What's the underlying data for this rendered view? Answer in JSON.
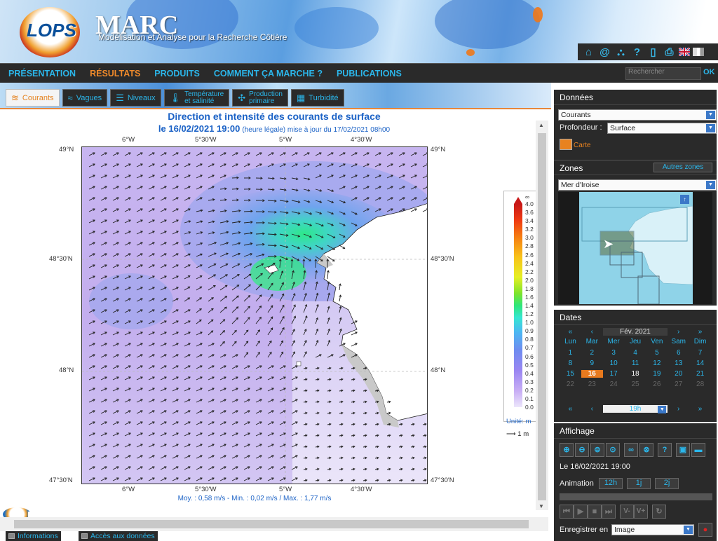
{
  "header": {
    "logo": "LOPS",
    "title": "MARC",
    "subtitle": "Modélisation et Analyse pour la Recherche Côtière"
  },
  "tools": [
    "home-icon",
    "at-icon",
    "sitemap-icon",
    "help-icon",
    "mobile-icon",
    "print-icon",
    "flag-uk-icon",
    "flag-fr-icon"
  ],
  "nav": {
    "items": [
      "PRÉSENTATION",
      "RÉSULTATS",
      "PRODUITS",
      "COMMENT ÇA MARCHE ?",
      "PUBLICATIONS"
    ],
    "active": "RÉSULTATS",
    "search_placeholder": "Rechercher",
    "search_ok": "OK"
  },
  "tabs": [
    {
      "label": "Courants",
      "active": true
    },
    {
      "label": "Vagues"
    },
    {
      "label": "Niveaux"
    },
    {
      "label1": "Température",
      "label2": "et salinité"
    },
    {
      "label1": "Production",
      "label2": "primaire"
    },
    {
      "label": "Turbidité"
    }
  ],
  "map": {
    "title": "Direction et intensité des courants de surface",
    "date": "le 16/02/2021 19:00",
    "date_note": "(heure légale) mise à jour du 17/02/2021 08h00",
    "lon_labels": [
      "6°W",
      "5°30'W",
      "5°W",
      "4°30'W"
    ],
    "lat_labels": [
      "49°N",
      "48°30'N",
      "48°N",
      "47°30'N"
    ],
    "stats": "Moy. : 0,58 m/s   -   Min. : 0,02 m/s / Max. : 1,77 m/s",
    "colorbar_ticks": [
      "4.0",
      "3.6",
      "3.4",
      "3.2",
      "3.0",
      "2.8",
      "2.6",
      "2.4",
      "2.2",
      "2.0",
      "1.8",
      "1.6",
      "1.4",
      "1.2",
      "1.0",
      "0.9",
      "0.8",
      "0.7",
      "0.6",
      "0.5",
      "0.4",
      "0.3",
      "0.2",
      "0.1",
      "0.0"
    ],
    "colorbar_top": "∞",
    "unit_label": "Unité: m",
    "scale_label": "1 m"
  },
  "footer": {
    "info": "Informations",
    "access": "Accès aux données"
  },
  "panel_data": {
    "title": "Données",
    "variable": "Courants",
    "depth_label": "Profondeur :",
    "depth": "Surface",
    "map_link": "Carte"
  },
  "panel_zones": {
    "title": "Zones",
    "other_btn": "Autres zones",
    "zone": "Mer d'Iroise"
  },
  "panel_dates": {
    "title": "Dates",
    "nav_prev2": "«",
    "nav_prev": "‹",
    "month": "Fév. 2021",
    "nav_next": "›",
    "nav_next2": "»",
    "weekdays": [
      "Lun",
      "Mar",
      "Mer",
      "Jeu",
      "Ven",
      "Sam",
      "Dim"
    ],
    "weeks": [
      [
        "1",
        "2",
        "3",
        "4",
        "5",
        "6",
        "7"
      ],
      [
        "8",
        "9",
        "10",
        "11",
        "12",
        "13",
        "14"
      ],
      [
        "15",
        "16",
        "17",
        "18",
        "19",
        "20",
        "21"
      ],
      [
        "22",
        "23",
        "24",
        "25",
        "26",
        "27",
        "28"
      ]
    ],
    "hour": "19h"
  },
  "panel_display": {
    "title": "Affichage",
    "current": "Le 16/02/2021 19:00",
    "anim_label": "Animation",
    "anim_btns": [
      "12h",
      "1j",
      "2j"
    ],
    "speed_btns": [
      "V-",
      "V+"
    ],
    "save_label": "Enregistrer en",
    "save_format": "Image"
  },
  "colors": {
    "accent": "#2bb6ea",
    "active": "#e8821f",
    "panel_bg": "#2a2a2a",
    "map_title": "#1b62c6"
  }
}
